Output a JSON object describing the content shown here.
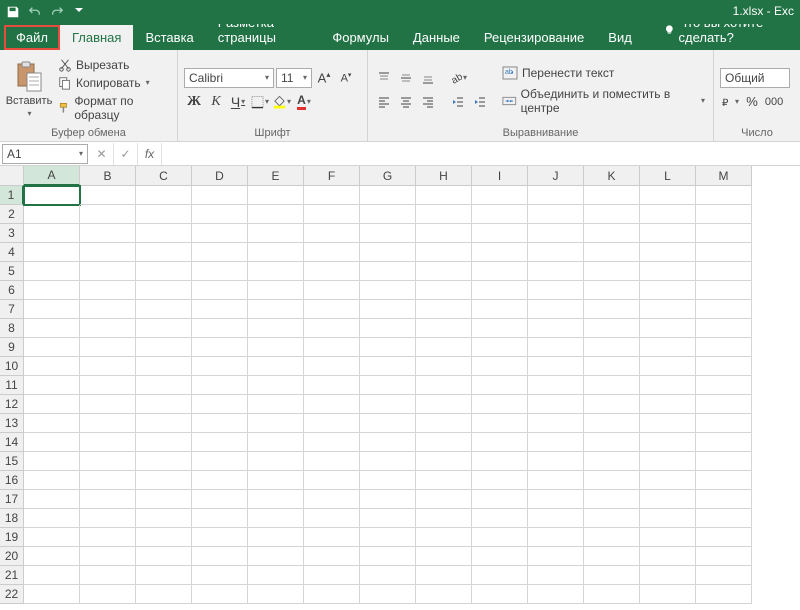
{
  "titlebar": {
    "filename": "1.xlsx - Exc"
  },
  "tabs": {
    "file": "Файл",
    "home": "Главная",
    "insert": "Вставка",
    "layout": "Разметка страницы",
    "formulas": "Формулы",
    "data": "Данные",
    "review": "Рецензирование",
    "view": "Вид",
    "tellme": "Что вы хотите сделать?"
  },
  "ribbon": {
    "clipboard": {
      "paste": "Вставить",
      "cut": "Вырезать",
      "copy": "Копировать",
      "formatpainter": "Формат по образцу",
      "label": "Буфер обмена"
    },
    "font": {
      "name": "Calibri",
      "size": "11",
      "bold": "Ж",
      "italic": "К",
      "underline": "Ч",
      "label": "Шрифт"
    },
    "alignment": {
      "wrap": "Перенести текст",
      "merge": "Объединить и поместить в центре",
      "label": "Выравнивание"
    },
    "number": {
      "format": "Общий",
      "label": "Число"
    }
  },
  "formulabar": {
    "namebox": "A1",
    "fx": "fx"
  },
  "grid": {
    "cols": [
      "A",
      "B",
      "C",
      "D",
      "E",
      "F",
      "G",
      "H",
      "I",
      "J",
      "K",
      "L",
      "M"
    ],
    "rows": 22,
    "activeCell": "A1"
  }
}
